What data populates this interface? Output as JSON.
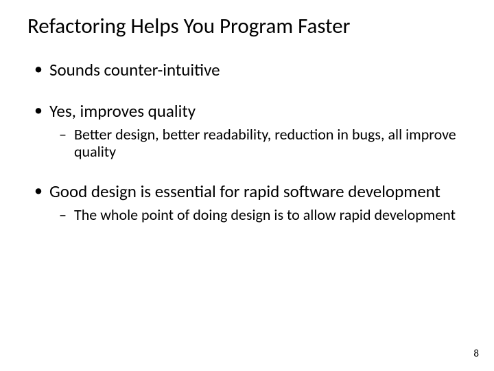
{
  "slide": {
    "title": "Refactoring Helps You Program Faster",
    "bullets": [
      {
        "level": 1,
        "text": "Sounds counter-intuitive",
        "tight": false
      },
      {
        "level": 1,
        "text": "Yes, improves quality",
        "tight": true
      },
      {
        "level": 2,
        "text": "Better design, better readability, reduction in bugs, all improve quality",
        "tight": false
      },
      {
        "level": 1,
        "text": "Good design is essential for rapid software development",
        "tight": true
      },
      {
        "level": 2,
        "text": "The whole point of doing design is to allow rapid development",
        "tight": false
      }
    ],
    "page_number": "8"
  }
}
